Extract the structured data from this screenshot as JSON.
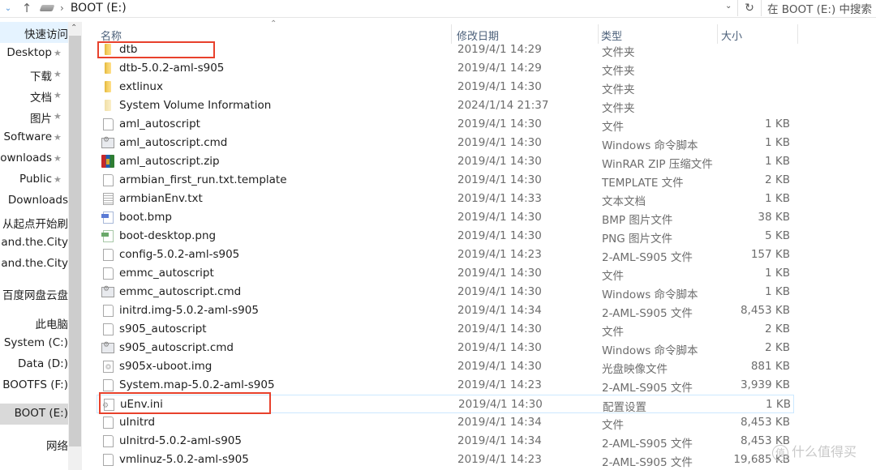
{
  "addressbar": {
    "path": "BOOT (E:)",
    "search_placeholder": "在 BOOT (E:) 中搜索",
    "icons": [
      "chevron-down-icon",
      "arrow-up-icon",
      "drive-icon",
      "chevron-right-icon",
      "refresh-icon"
    ]
  },
  "sidebar": {
    "items": [
      {
        "label": "快速访问",
        "pinned": false,
        "state": "quick"
      },
      {
        "label": "Desktop",
        "pinned": true
      },
      {
        "label": "下载",
        "pinned": true
      },
      {
        "label": "文档",
        "pinned": true
      },
      {
        "label": "图片",
        "pinned": true
      },
      {
        "label": "Software",
        "pinned": true
      },
      {
        "label": "Downloads",
        "pinned": true
      },
      {
        "label": "Public",
        "pinned": true
      },
      {
        "label": "Downloads",
        "pinned": false
      },
      {
        "label": "从起点开始刷",
        "pinned": false
      },
      {
        "label": "Sex.and.the.City",
        "pinned": false
      },
      {
        "label": "Sex.and.the.City",
        "pinned": false
      },
      {
        "label": "百度网盘云盘",
        "pinned": false
      },
      {
        "label": "此电脑",
        "pinned": false
      },
      {
        "label": "System (C:)",
        "pinned": false
      },
      {
        "label": "Data (D:)",
        "pinned": false
      },
      {
        "label": "BOOTFS (F:)",
        "pinned": false
      },
      {
        "label": "BOOT (E:)",
        "pinned": false,
        "state": "selected"
      },
      {
        "label": "网络",
        "pinned": false
      }
    ]
  },
  "columns": {
    "name": "名称",
    "date": "修改日期",
    "type": "类型",
    "size": "大小"
  },
  "files": [
    {
      "name": "dtb",
      "date": "2019/4/1 14:29",
      "type": "文件夹",
      "size": "",
      "icon": "folder",
      "highlighted": true
    },
    {
      "name": "dtb-5.0.2-aml-s905",
      "date": "2019/4/1 14:29",
      "type": "文件夹",
      "size": "",
      "icon": "folder"
    },
    {
      "name": "extlinux",
      "date": "2019/4/1 14:30",
      "type": "文件夹",
      "size": "",
      "icon": "folder"
    },
    {
      "name": "System Volume Information",
      "date": "2024/1/14 21:37",
      "type": "文件夹",
      "size": "",
      "icon": "folder-hidden"
    },
    {
      "name": "aml_autoscript",
      "date": "2019/4/1 14:30",
      "type": "文件",
      "size": "1 KB",
      "icon": "file"
    },
    {
      "name": "aml_autoscript.cmd",
      "date": "2019/4/1 14:30",
      "type": "Windows 命令脚本",
      "size": "1 KB",
      "icon": "cmd"
    },
    {
      "name": "aml_autoscript.zip",
      "date": "2019/4/1 14:30",
      "type": "WinRAR ZIP 压缩文件",
      "size": "1 KB",
      "icon": "zip"
    },
    {
      "name": "armbian_first_run.txt.template",
      "date": "2019/4/1 14:30",
      "type": "TEMPLATE 文件",
      "size": "2 KB",
      "icon": "file"
    },
    {
      "name": "armbianEnv.txt",
      "date": "2019/4/1 14:33",
      "type": "文本文档",
      "size": "1 KB",
      "icon": "txt"
    },
    {
      "name": "boot.bmp",
      "date": "2019/4/1 14:30",
      "type": "BMP 图片文件",
      "size": "38 KB",
      "icon": "bmp"
    },
    {
      "name": "boot-desktop.png",
      "date": "2019/4/1 14:30",
      "type": "PNG 图片文件",
      "size": "5 KB",
      "icon": "png"
    },
    {
      "name": "config-5.0.2-aml-s905",
      "date": "2019/4/1 14:23",
      "type": "2-AML-S905 文件",
      "size": "157 KB",
      "icon": "file"
    },
    {
      "name": "emmc_autoscript",
      "date": "2019/4/1 14:30",
      "type": "文件",
      "size": "1 KB",
      "icon": "file"
    },
    {
      "name": "emmc_autoscript.cmd",
      "date": "2019/4/1 14:30",
      "type": "Windows 命令脚本",
      "size": "1 KB",
      "icon": "cmd"
    },
    {
      "name": "initrd.img-5.0.2-aml-s905",
      "date": "2019/4/1 14:34",
      "type": "2-AML-S905 文件",
      "size": "8,453 KB",
      "icon": "file"
    },
    {
      "name": "s905_autoscript",
      "date": "2019/4/1 14:30",
      "type": "文件",
      "size": "2 KB",
      "icon": "file"
    },
    {
      "name": "s905_autoscript.cmd",
      "date": "2019/4/1 14:30",
      "type": "Windows 命令脚本",
      "size": "2 KB",
      "icon": "cmd"
    },
    {
      "name": "s905x-uboot.img",
      "date": "2019/4/1 14:30",
      "type": "光盘映像文件",
      "size": "881 KB",
      "icon": "img"
    },
    {
      "name": "System.map-5.0.2-aml-s905",
      "date": "2019/4/1 14:23",
      "type": "2-AML-S905 文件",
      "size": "3,939 KB",
      "icon": "file"
    },
    {
      "name": "uEnv.ini",
      "date": "2019/4/1 14:30",
      "type": "配置设置",
      "size": "1 KB",
      "icon": "ini",
      "highlighted": true,
      "hover": true
    },
    {
      "name": "uInitrd",
      "date": "2019/4/1 14:34",
      "type": "文件",
      "size": "8,453 KB",
      "icon": "file"
    },
    {
      "name": "uInitrd-5.0.2-aml-s905",
      "date": "2019/4/1 14:34",
      "type": "2-AML-S905 文件",
      "size": "8,453 KB",
      "icon": "file"
    },
    {
      "name": "vmlinuz-5.0.2-aml-s905",
      "date": "2019/4/1 14:23",
      "type": "2-AML-S905 文件",
      "size": "19,685 KB",
      "icon": "file"
    }
  ],
  "highlight_color": "#e8412c",
  "watermark": {
    "badge": "值",
    "text": "什么值得买"
  }
}
